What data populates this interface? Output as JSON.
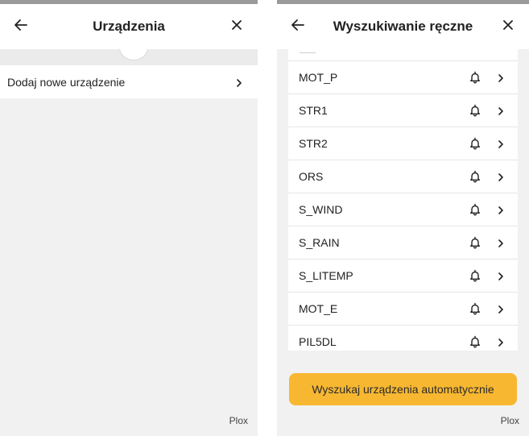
{
  "left_screen": {
    "title": "Urządzenia",
    "add_device_label": "Dodaj nowe urządzenie",
    "footer": "Plox"
  },
  "right_screen": {
    "title": "Wyszukiwanie ręczne",
    "devices": [
      {
        "name": "MOT_P"
      },
      {
        "name": "STR1"
      },
      {
        "name": "STR2"
      },
      {
        "name": "ORS"
      },
      {
        "name": "S_WIND"
      },
      {
        "name": "S_RAIN"
      },
      {
        "name": "S_LITEMP"
      },
      {
        "name": "MOT_E"
      },
      {
        "name": "PIL5DL"
      }
    ],
    "auto_search_label": "Wyszukaj urządzenia automatycznie",
    "footer": "Plox"
  },
  "colors": {
    "accent": "#f7b731",
    "background": "#f1f1f1",
    "card": "#ffffff"
  },
  "icons": [
    "back-arrow-icon",
    "close-icon",
    "chevron-right-icon",
    "bell-icon"
  ]
}
